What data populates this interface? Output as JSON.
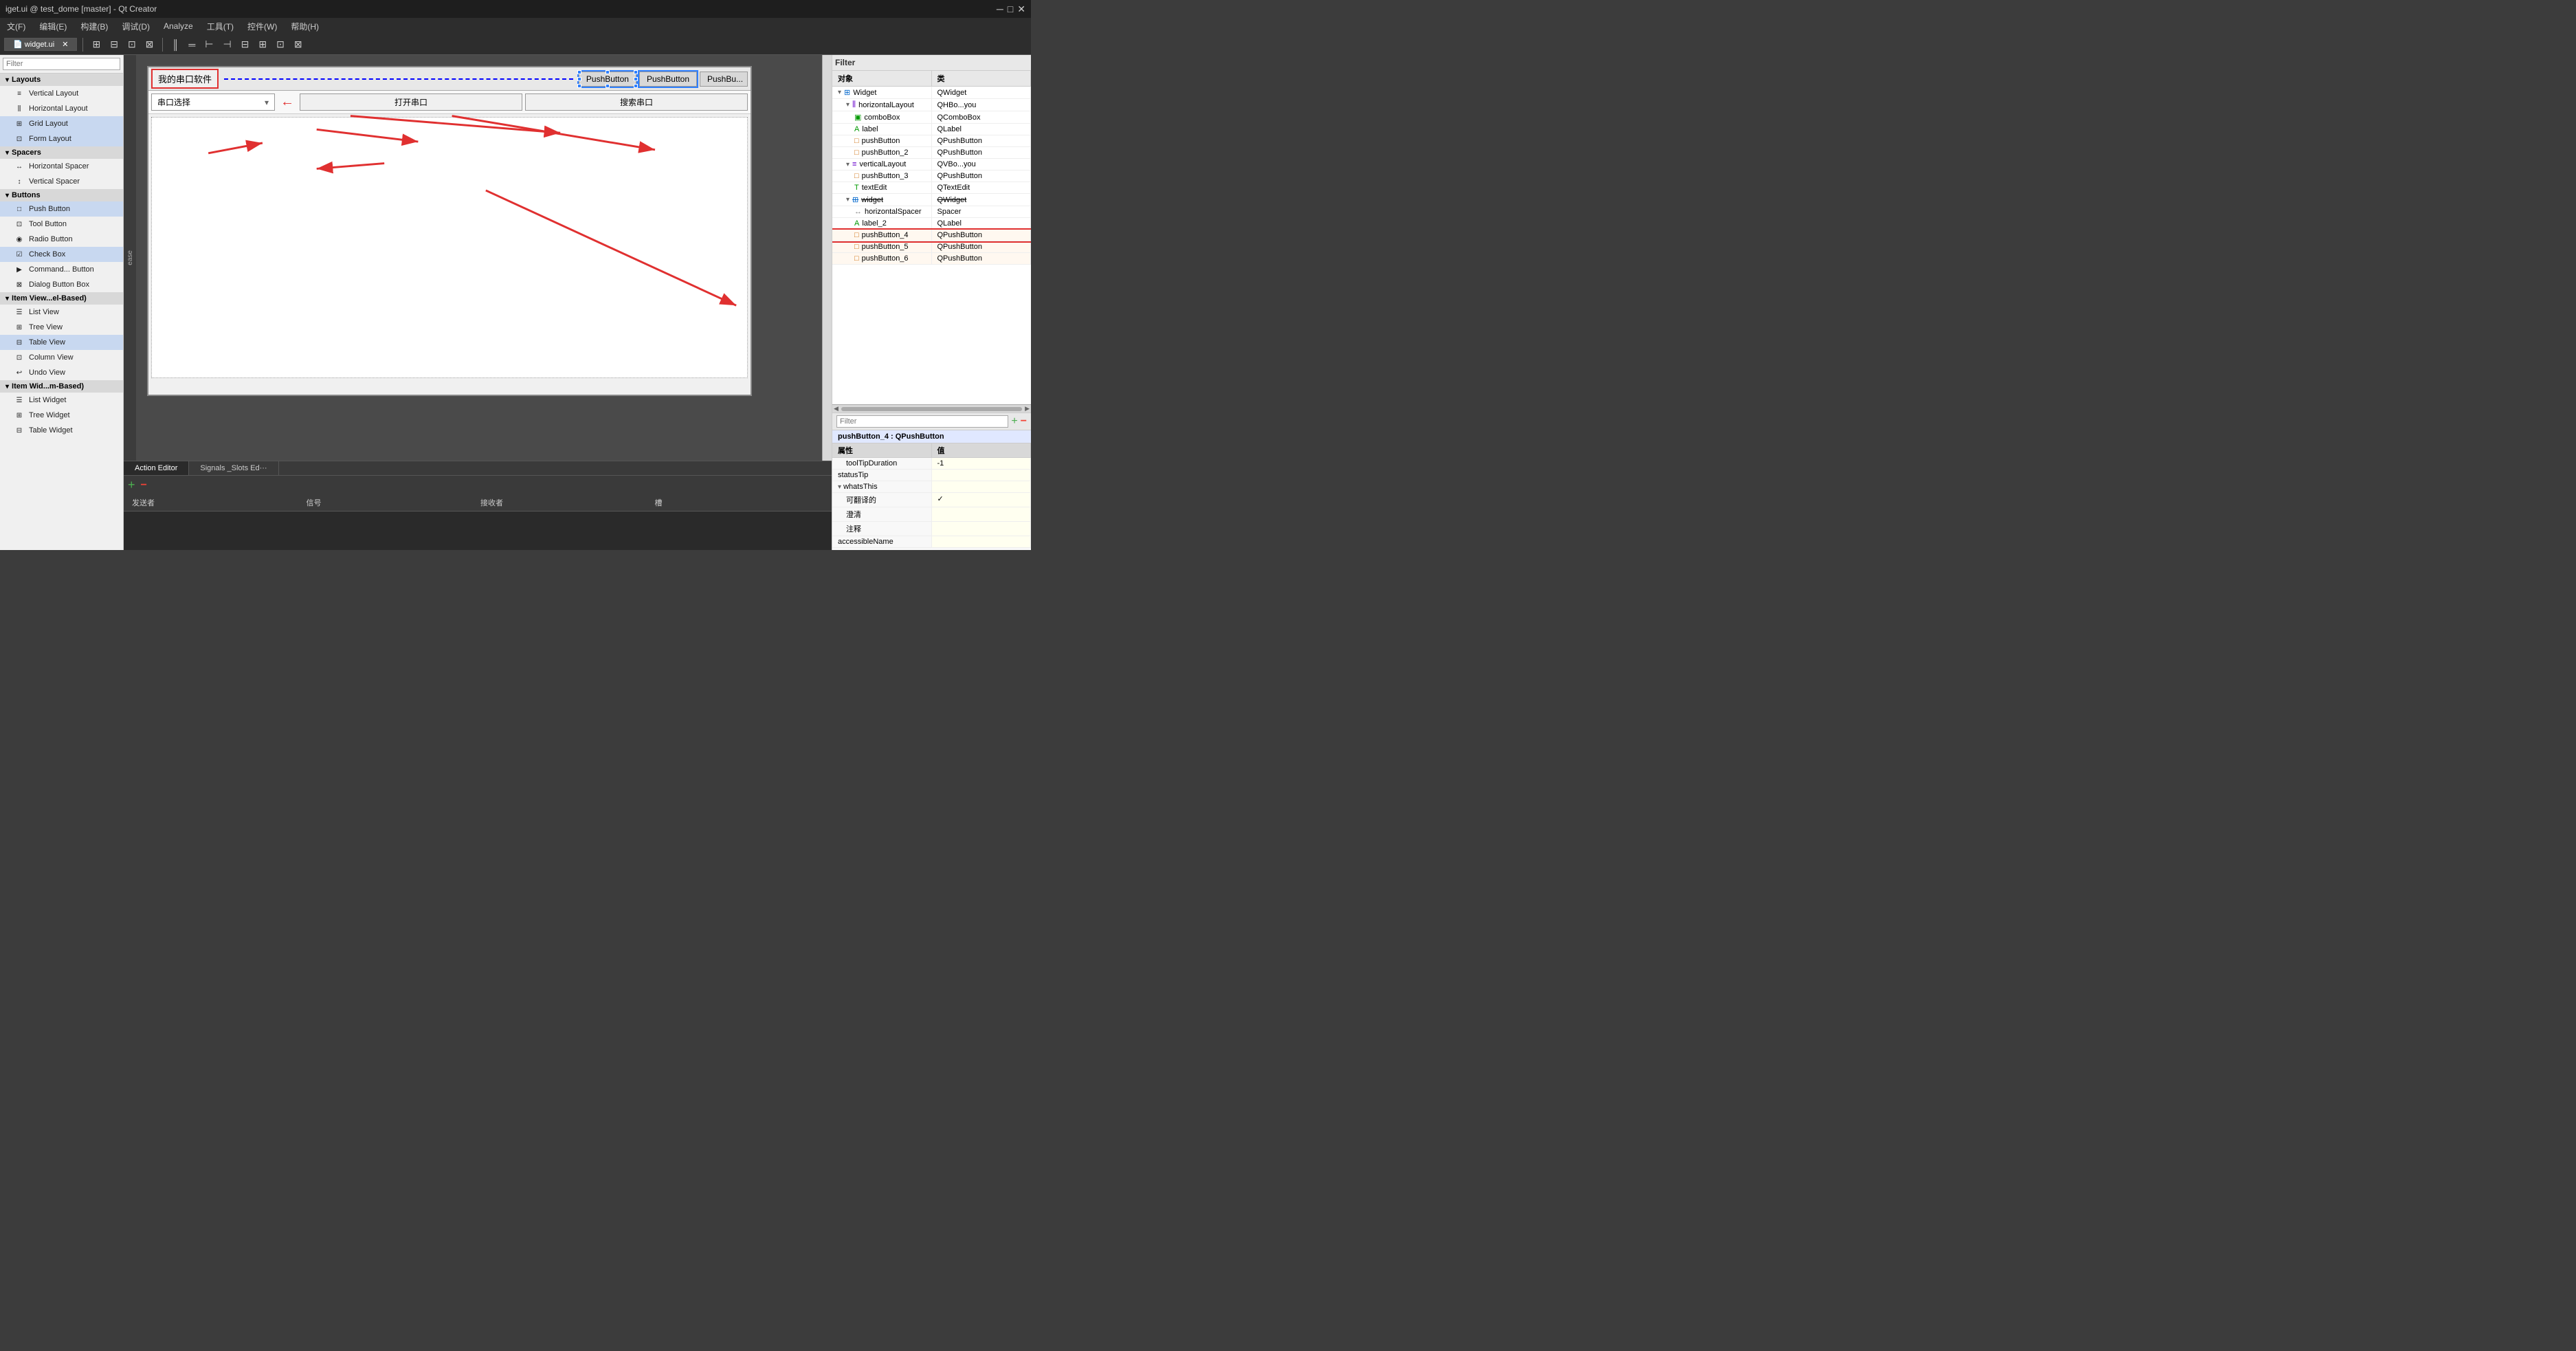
{
  "titleBar": {
    "title": "iget.ui @ test_dome [master] - Qt Creator",
    "minBtn": "─",
    "maxBtn": "□",
    "closeBtn": "✕"
  },
  "menuBar": {
    "items": [
      "文(F)",
      "编辑(E)",
      "构建(B)",
      "调试(D)",
      "Analyze",
      "工具(T)",
      "控件(W)",
      "帮助(H)"
    ]
  },
  "toolbar": {
    "fileTab": "widget.ui",
    "closeBtn": "✕",
    "buttons": [
      "▣",
      "⊞",
      "⊡",
      "⊟",
      "║",
      "═",
      "⊢",
      "⊣",
      "⊟",
      "⊞",
      "⊡",
      "⊠"
    ]
  },
  "leftSidebar": {
    "filterPlaceholder": "Filter",
    "sections": [
      {
        "name": "Layouts",
        "items": [
          {
            "label": "Vertical Layout",
            "icon": "≡"
          },
          {
            "label": "Horizontal Layout",
            "icon": "⫼"
          },
          {
            "label": "Grid Layout",
            "icon": "⊞",
            "highlight": true
          },
          {
            "label": "Form Layout",
            "icon": "⊡",
            "highlight": true
          }
        ]
      },
      {
        "name": "Spacers",
        "items": [
          {
            "label": "Horizontal Spacer",
            "icon": "↔"
          },
          {
            "label": "Vertical Spacer",
            "icon": "↕"
          }
        ]
      },
      {
        "name": "Buttons",
        "items": [
          {
            "label": "Push Button",
            "icon": "□",
            "highlight": true
          },
          {
            "label": "Tool Button",
            "icon": "⊡"
          },
          {
            "label": "Radio Button",
            "icon": "◉"
          },
          {
            "label": "Check Box",
            "icon": "☑",
            "highlight": true
          },
          {
            "label": "Command... Button",
            "icon": "▶"
          },
          {
            "label": "Dialog Button Box",
            "icon": "⊠"
          }
        ]
      },
      {
        "name": "Item View...el-Based)",
        "items": [
          {
            "label": "List View",
            "icon": "☰"
          },
          {
            "label": "Tree View",
            "icon": "⊞"
          },
          {
            "label": "Table View",
            "icon": "⊟",
            "highlight": true
          },
          {
            "label": "Column View",
            "icon": "⊡"
          },
          {
            "label": "Undo View",
            "icon": "↩"
          }
        ]
      },
      {
        "name": "Item Wid...m-Based)",
        "items": [
          {
            "label": "List Widget",
            "icon": "☰"
          },
          {
            "label": "Tree Widget",
            "icon": "⊞"
          },
          {
            "label": "Table Widget",
            "icon": "⊟"
          }
        ]
      }
    ]
  },
  "canvas": {
    "myLabel": "我的串口软件",
    "pushButtons": [
      "PushButton",
      "PushButton",
      "PushBu..."
    ],
    "row2": {
      "comboLabel": "串口选择",
      "openBtn": "打开串口",
      "searchBtn": "搜索串口"
    }
  },
  "signalEditor": {
    "tabs": [
      "Action Editor",
      "Signals _Slots Ed···"
    ],
    "addBtn": "+",
    "removeBtn": "−",
    "columns": [
      "发送者",
      "信号",
      "接收者",
      "槽"
    ]
  },
  "rightSidebar": {
    "filterLabel": "Filter",
    "filterPlaceholder": "",
    "objectTree": {
      "headers": [
        "对象",
        "类"
      ],
      "items": [
        {
          "indent": 0,
          "expand": "▾",
          "name": "Widget",
          "cls": "QWidget",
          "icon": "W",
          "selected": false
        },
        {
          "indent": 1,
          "expand": "▾",
          "name": "horizontalLayout",
          "cls": "QHBo...you",
          "icon": "H"
        },
        {
          "indent": 2,
          "expand": "",
          "name": "comboBox",
          "cls": "QComboBox",
          "icon": "C"
        },
        {
          "indent": 2,
          "expand": "",
          "name": "label",
          "cls": "QLabel",
          "icon": "L"
        },
        {
          "indent": 2,
          "expand": "",
          "name": "pushButton",
          "cls": "QPushButton",
          "icon": "P"
        },
        {
          "indent": 2,
          "expand": "",
          "name": "pushButton_2",
          "cls": "QPushButton",
          "icon": "P"
        },
        {
          "indent": 1,
          "expand": "▾",
          "name": "verticalLayout",
          "cls": "QVBo...you",
          "icon": "V"
        },
        {
          "indent": 2,
          "expand": "",
          "name": "pushButton_3",
          "cls": "QPushButton",
          "icon": "P"
        },
        {
          "indent": 2,
          "expand": "",
          "name": "textEdit",
          "cls": "QTextEdit",
          "icon": "T"
        },
        {
          "indent": 1,
          "expand": "▾",
          "name": "widget",
          "cls": "QWidget",
          "icon": "W",
          "strikeStyle": true
        },
        {
          "indent": 2,
          "expand": "",
          "name": "horizontalSpacer",
          "cls": "Spacer",
          "icon": "S"
        },
        {
          "indent": 2,
          "expand": "",
          "name": "label_2",
          "cls": "QLabel",
          "icon": "L"
        },
        {
          "indent": 2,
          "expand": "",
          "name": "pushButton_4",
          "cls": "QPushButton",
          "icon": "P",
          "selected": true
        },
        {
          "indent": 2,
          "expand": "",
          "name": "pushButton_5",
          "cls": "QPushButton",
          "icon": "P"
        },
        {
          "indent": 2,
          "expand": "",
          "name": "pushButton_6",
          "cls": "QPushButton",
          "icon": "P"
        }
      ]
    }
  },
  "propertiesPanel": {
    "filterPlaceholder": "Filter",
    "context": "pushButton_4 : QPushButton",
    "headers": [
      "属性",
      "值"
    ],
    "rows": [
      {
        "indent": 1,
        "prop": "toolTipDuration",
        "value": "-1"
      },
      {
        "indent": 0,
        "prop": "statusTip",
        "value": ""
      },
      {
        "indent": 0,
        "expand": "▾",
        "prop": "whatsThis",
        "value": ""
      },
      {
        "indent": 1,
        "prop": "可翻译的",
        "value": "✓"
      },
      {
        "indent": 1,
        "prop": "澄清",
        "value": ""
      },
      {
        "indent": 1,
        "prop": "注释",
        "value": ""
      },
      {
        "indent": 0,
        "prop": "accessibleName",
        "value": ""
      }
    ]
  },
  "leftEdge": {
    "label": "ease"
  }
}
